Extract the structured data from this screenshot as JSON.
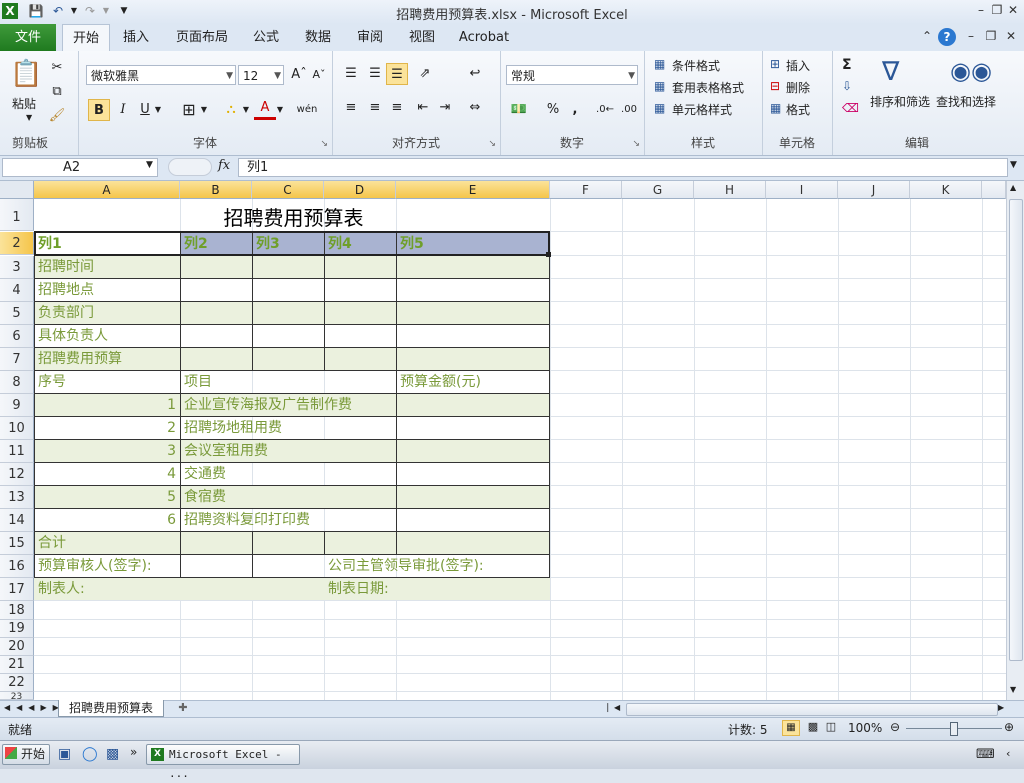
{
  "window": {
    "title": "招聘费用预算表.xlsx  -  Microsoft Excel"
  },
  "ribbon_tabs": {
    "file": "文件",
    "items": [
      "开始",
      "插入",
      "页面布局",
      "公式",
      "数据",
      "审阅",
      "视图",
      "Acrobat"
    ],
    "active": "开始"
  },
  "ribbon": {
    "paste_label": "粘贴",
    "clipboard_label": "剪贴板",
    "font_name": "微软雅黑",
    "font_size": "12",
    "font_group_label": "字体",
    "bold": "B",
    "italic": "I",
    "underline": "U",
    "font_color_letter": "A",
    "phonetic": "wén",
    "align_group_label": "对齐方式",
    "number_format": "常规",
    "number_group_label": "数字",
    "percent": "%",
    "comma": ",",
    "conditional_format": "条件格式",
    "table_format": "套用表格格式",
    "cell_style": "单元格样式",
    "styles_group_label": "样式",
    "insert": "插入",
    "delete": "删除",
    "format": "格式",
    "cells_group_label": "单元格",
    "sort_filter": "排序和筛选",
    "find_select": "查找和选择",
    "edit_group_label": "编辑",
    "sigma": "Σ"
  },
  "formula_bar": {
    "name_box": "A2",
    "fx_symbol": "fx",
    "formula": "列1"
  },
  "columns": [
    "A",
    "B",
    "C",
    "D",
    "E",
    "F",
    "G",
    "H",
    "I",
    "J",
    "K"
  ],
  "rows": [
    "1",
    "2",
    "3",
    "4",
    "5",
    "6",
    "7",
    "8",
    "9",
    "10",
    "11",
    "12",
    "13",
    "14",
    "15",
    "16",
    "17",
    "18",
    "19",
    "20",
    "21",
    "22",
    "23"
  ],
  "sheet": {
    "title": "招聘费用预算表",
    "header_row": [
      "列1",
      "列2",
      "列3",
      "列4",
      "列5"
    ],
    "r3": "招聘时间",
    "r4": "招聘地点",
    "r5": "负责部门",
    "r6": "具体负责人",
    "r7": "招聘费用预算",
    "r8_a": "序号",
    "r8_b": "项目",
    "r8_e": "预算金额(元)",
    "items": [
      {
        "no": "1",
        "name": "企业宣传海报及广告制作费"
      },
      {
        "no": "2",
        "name": "招聘场地租用费"
      },
      {
        "no": "3",
        "name": "会议室租用费"
      },
      {
        "no": "4",
        "name": "交通费"
      },
      {
        "no": "5",
        "name": "食宿费"
      },
      {
        "no": "6",
        "name": "招聘资料复印打印费"
      }
    ],
    "r15": "合计",
    "r16_a": "预算审核人(签字):",
    "r16_d": "公司主管领导审批(签字):",
    "r17_a": "制表人:",
    "r17_d": "制表日期:"
  },
  "sheet_tabs": {
    "active": "招聘费用预算表"
  },
  "status": {
    "ready": "就绪",
    "count": "计数: 5",
    "zoom": "100%"
  },
  "taskbar": {
    "start": "开始",
    "task": "Microsoft Excel - ..."
  },
  "colors": {
    "band": "#ebf1de",
    "header_fill": "#a9b3d1",
    "text_green": "#7a9a3a",
    "file_tab": "#2a8a2a"
  }
}
